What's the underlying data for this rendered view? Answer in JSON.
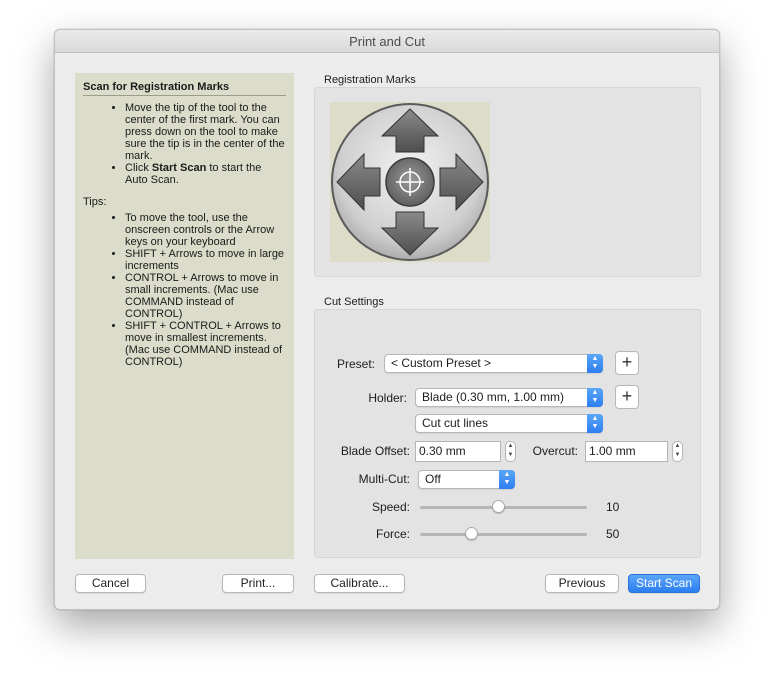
{
  "window": {
    "title": "Print and Cut"
  },
  "instructions": {
    "heading": "Scan for Registration Marks",
    "step1": "Move the tip of the tool to the center of the first mark. You can press down on the tool to make sure the tip is in the center of the mark.",
    "step2_prefix": "Click ",
    "step2_bold": "Start Scan",
    "step2_suffix": " to start the Auto Scan.",
    "tips_label": "Tips:",
    "tips": [
      "To move the tool, use the onscreen controls or the Arrow keys on your keyboard",
      "SHIFT + Arrows to move in large increments",
      "CONTROL + Arrows to move in small increments. (Mac use COMMAND instead of CONTROL)",
      "SHIFT + CONTROL + Arrows to move in smallest increments. (Mac use COMMAND instead of CONTROL)"
    ]
  },
  "registration": {
    "label": "Registration Marks"
  },
  "cut_settings": {
    "label": "Cut Settings",
    "preset_label": "Preset:",
    "preset_value": "< Custom Preset >",
    "holder_label": "Holder:",
    "holder_value": "Blade (0.30 mm, 1.00 mm)",
    "cut_mode_value": "Cut cut lines",
    "blade_offset_label": "Blade Offset:",
    "blade_offset_value": "0.30 mm",
    "overcut_label": "Overcut:",
    "overcut_value": "1.00 mm",
    "multicut_label": "Multi-Cut:",
    "multicut_value": "Off",
    "speed_label": "Speed:",
    "speed_value": "10",
    "speed_fraction": 0.47,
    "force_label": "Force:",
    "force_value": "50",
    "force_fraction": 0.31
  },
  "buttons": {
    "cancel": "Cancel",
    "print": "Print...",
    "calibrate": "Calibrate...",
    "previous": "Previous",
    "start_scan": "Start Scan",
    "plus": "+"
  },
  "colors": {
    "accent": "#2d7ef0",
    "panel": "#dcdccb"
  }
}
